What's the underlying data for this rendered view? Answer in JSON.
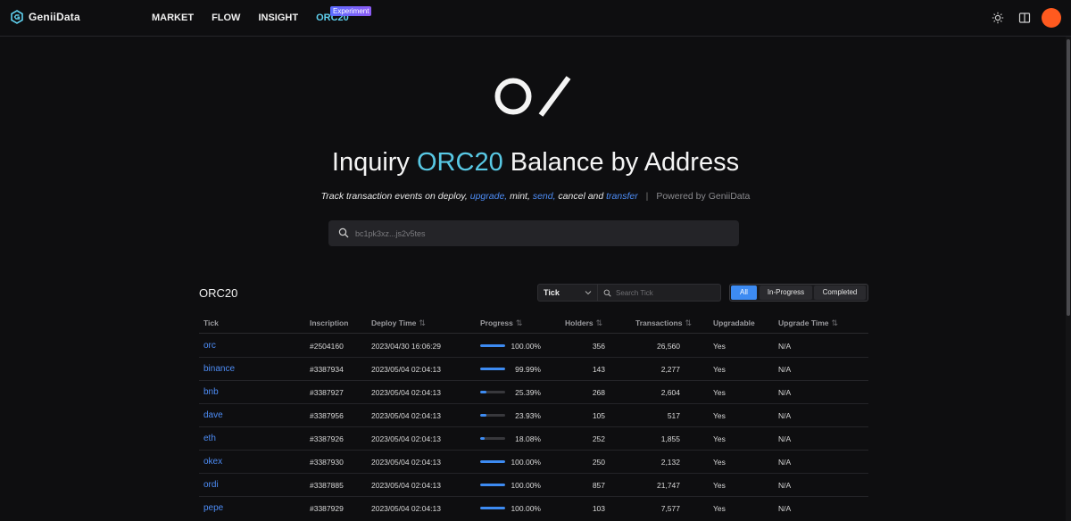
{
  "app": {
    "brand": "GeniiData",
    "accent_color": "#58c8e4",
    "link_color": "#4d8cf5",
    "avatar_color": "#ff5a1f"
  },
  "nav": {
    "items": [
      {
        "label": "MARKET"
      },
      {
        "label": "FLOW"
      },
      {
        "label": "INSIGHT"
      },
      {
        "label": "ORC20",
        "active": true
      }
    ],
    "badge": "Experiment"
  },
  "header_icons": [
    "sun-icon",
    "panel-icon"
  ],
  "hero": {
    "title_prefix": "Inquiry ",
    "title_accent": "ORC20",
    "title_suffix": " Balance by Address",
    "sub": {
      "t1": "Track transaction events on ",
      "deploy": "deploy,",
      "upgrade": "upgrade,",
      "mint": "mint,",
      "send": "send,",
      "cancel_and": "cancel and",
      "transfer": "transfer",
      "sep": "|",
      "powered": "Powered by GeniiData"
    },
    "search_placeholder": "bc1pk3xz...js2v5tes"
  },
  "section": {
    "title": "ORC20",
    "tick_select": "Tick",
    "tick_search_placeholder": "Search Tick",
    "filters": {
      "all": "All",
      "in_progress": "In-Progress",
      "completed": "Completed",
      "selected": "All"
    }
  },
  "table": {
    "headers": {
      "tick": "Tick",
      "inscription": "Inscription",
      "deploy_time": "Deploy Time",
      "progress": "Progress",
      "holders": "Holders",
      "transactions": "Transactions",
      "upgradable": "Upgradable",
      "upgrade_time": "Upgrade Time"
    },
    "rows": [
      {
        "tick": "orc",
        "inscription": "#2504160",
        "deploy_time": "2023/04/30 16:06:29",
        "progress": 100.0,
        "progress_text": "100.00%",
        "holders": "356",
        "transactions": "26,560",
        "upgradable": "Yes",
        "upgrade_time": "N/A"
      },
      {
        "tick": "binance",
        "inscription": "#3387934",
        "deploy_time": "2023/05/04 02:04:13",
        "progress": 99.99,
        "progress_text": "99.99%",
        "holders": "143",
        "transactions": "2,277",
        "upgradable": "Yes",
        "upgrade_time": "N/A"
      },
      {
        "tick": "bnb",
        "inscription": "#3387927",
        "deploy_time": "2023/05/04 02:04:13",
        "progress": 25.39,
        "progress_text": "25.39%",
        "holders": "268",
        "transactions": "2,604",
        "upgradable": "Yes",
        "upgrade_time": "N/A"
      },
      {
        "tick": "dave",
        "inscription": "#3387956",
        "deploy_time": "2023/05/04 02:04:13",
        "progress": 23.93,
        "progress_text": "23.93%",
        "holders": "105",
        "transactions": "517",
        "upgradable": "Yes",
        "upgrade_time": "N/A"
      },
      {
        "tick": "eth",
        "inscription": "#3387926",
        "deploy_time": "2023/05/04 02:04:13",
        "progress": 18.08,
        "progress_text": "18.08%",
        "holders": "252",
        "transactions": "1,855",
        "upgradable": "Yes",
        "upgrade_time": "N/A"
      },
      {
        "tick": "okex",
        "inscription": "#3387930",
        "deploy_time": "2023/05/04 02:04:13",
        "progress": 100.0,
        "progress_text": "100.00%",
        "holders": "250",
        "transactions": "2,132",
        "upgradable": "Yes",
        "upgrade_time": "N/A"
      },
      {
        "tick": "ordi",
        "inscription": "#3387885",
        "deploy_time": "2023/05/04 02:04:13",
        "progress": 100.0,
        "progress_text": "100.00%",
        "holders": "857",
        "transactions": "21,747",
        "upgradable": "Yes",
        "upgrade_time": "N/A"
      },
      {
        "tick": "pepe",
        "inscription": "#3387929",
        "deploy_time": "2023/05/04 02:04:13",
        "progress": 100.0,
        "progress_text": "100.00%",
        "holders": "103",
        "transactions": "7,577",
        "upgradable": "Yes",
        "upgrade_time": "N/A"
      }
    ]
  }
}
